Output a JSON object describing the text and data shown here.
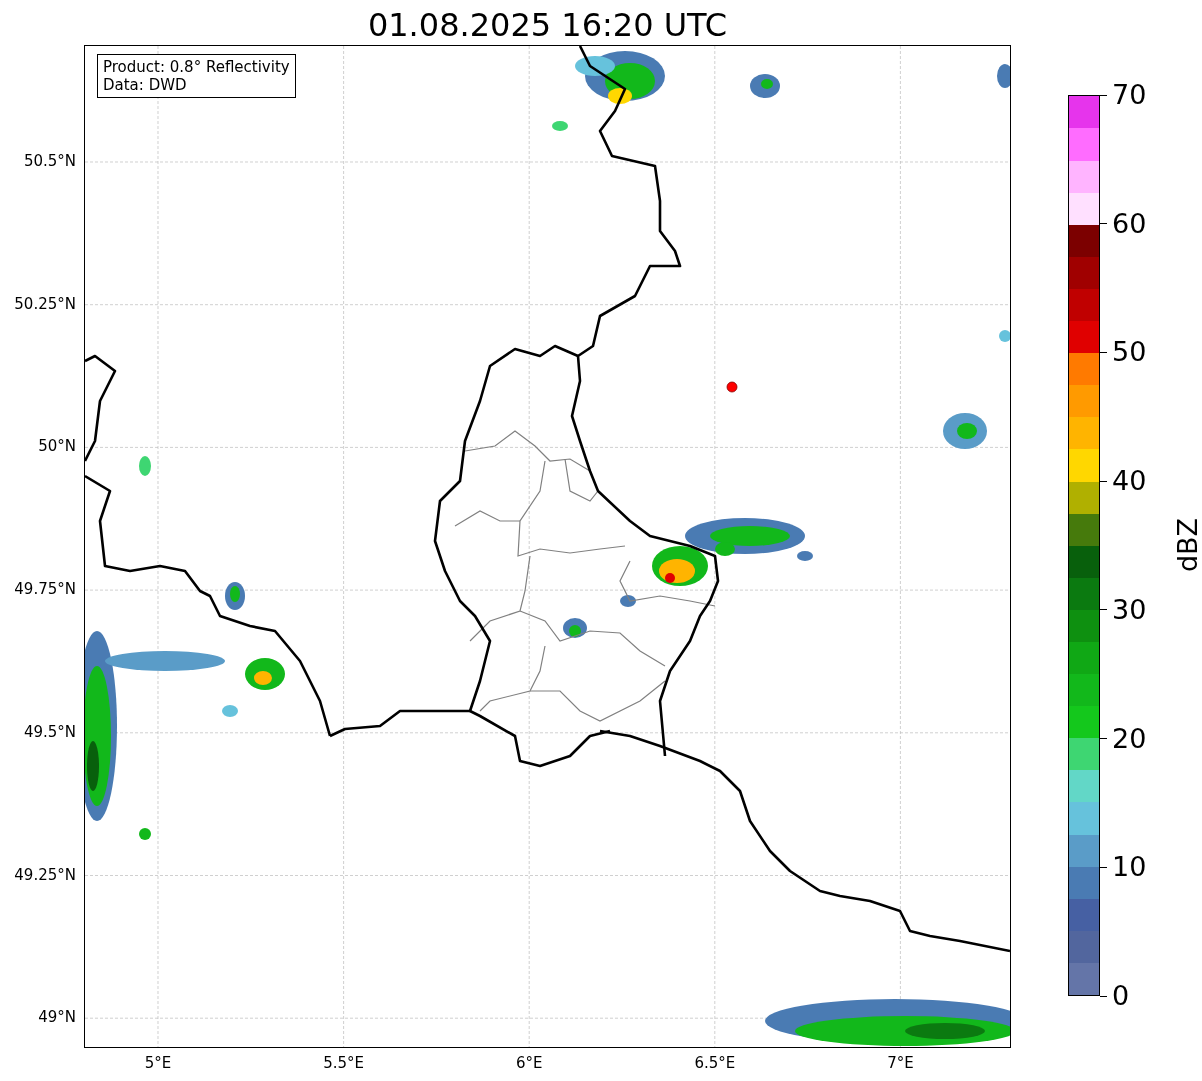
{
  "title": "01.08.2025 16:20 UTC",
  "legend": {
    "lines": [
      "Product: 0.8° Reflectivity",
      "Data: DWD"
    ]
  },
  "map": {
    "lat_ticks": [
      "50.5°N",
      "50.25°N",
      "50°N",
      "49.75°N",
      "49.5°N",
      "49.25°N",
      "49°N"
    ],
    "lon_ticks": [
      "5°E",
      "5.5°E",
      "6°E",
      "6.5°E",
      "7°E"
    ]
  },
  "colorbar": {
    "label": "dBZ",
    "ticks": [
      "70",
      "60",
      "50",
      "40",
      "30",
      "20",
      "10",
      "0"
    ],
    "segments": [
      {
        "color": "#6475a8"
      },
      {
        "color": "#52669e"
      },
      {
        "color": "#4660a3"
      },
      {
        "color": "#4a7bb3"
      },
      {
        "color": "#5a9cc8"
      },
      {
        "color": "#66c2dc"
      },
      {
        "color": "#62d7c7"
      },
      {
        "color": "#3ed672"
      },
      {
        "color": "#14c81c"
      },
      {
        "color": "#12b81b"
      },
      {
        "color": "#10a815"
      },
      {
        "color": "#0e9010"
      },
      {
        "color": "#0b7a10"
      },
      {
        "color": "#08600c"
      },
      {
        "color": "#467a0c"
      },
      {
        "color": "#b0b000"
      },
      {
        "color": "#ffd700"
      },
      {
        "color": "#ffb400"
      },
      {
        "color": "#ff9a00"
      },
      {
        "color": "#ff7a00"
      },
      {
        "color": "#e00000"
      },
      {
        "color": "#c00000"
      },
      {
        "color": "#a00000"
      },
      {
        "color": "#7c0000"
      },
      {
        "color": "#ffe0ff"
      },
      {
        "color": "#ffb4ff"
      },
      {
        "color": "#ff6cff"
      },
      {
        "color": "#e634ec"
      }
    ]
  }
}
